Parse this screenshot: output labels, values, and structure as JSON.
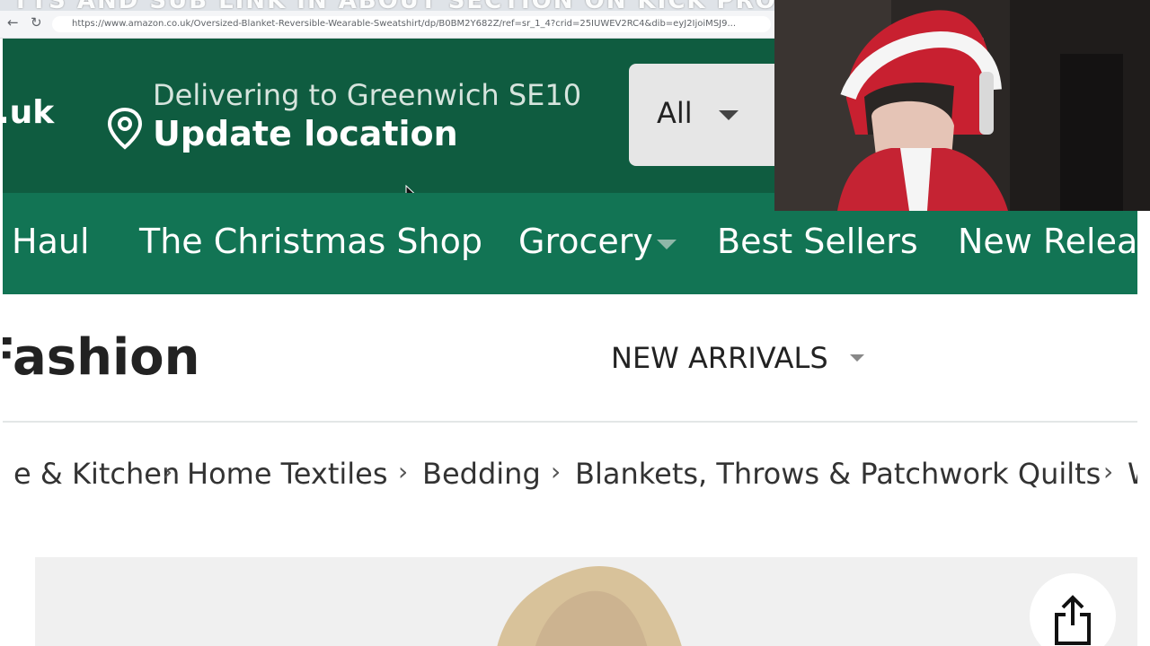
{
  "overlay": {
    "ticker_text": "TTS AND SUB LINK IN ABOUT SECTION ON KICK PROFILE"
  },
  "browser": {
    "back_icon": "back-arrow-icon",
    "reload_icon": "reload-icon",
    "url": "https://www.amazon.co.uk/Oversized-Blanket-Reversible-Wearable-Sweatshirt/dp/B0BM2Y682Z/ref=sr_1_4?crid=25IUWEV2RC4&dib=eyJ2IjoiMSJ9..."
  },
  "header": {
    "logo_suffix": ".uk",
    "deliver_text": "Delivering to Greenwich SE10",
    "update_location": "Update location",
    "search_category": "All",
    "background_color": "#0f5c40"
  },
  "nav": {
    "items": [
      "Haul",
      "The Christmas Shop",
      "Grocery",
      "Best Sellers",
      "New Releas"
    ],
    "background_color": "#127454"
  },
  "store": {
    "title": "Fashion",
    "menu_label": "NEW ARRIVALS"
  },
  "breadcrumb": {
    "items": [
      "e & Kitchen",
      "Home Textiles",
      "Bedding",
      "Blankets, Throws & Patchwork Quilts",
      "W"
    ],
    "separator": "›"
  },
  "product": {
    "share_icon": "share-icon"
  }
}
